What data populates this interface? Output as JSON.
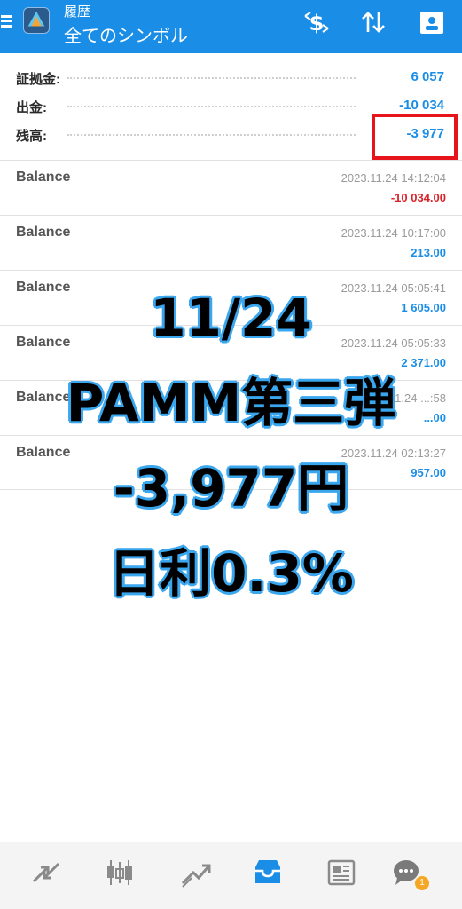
{
  "header": {
    "subtitle": "履歴",
    "title": "全てのシンボル",
    "icons": [
      "menu-icon",
      "app-logo",
      "currency-filter-icon",
      "sort-icon",
      "report-icon"
    ]
  },
  "summary": [
    {
      "label": "証拠金:",
      "value": "6 057"
    },
    {
      "label": "出金:",
      "value": "-10 034"
    },
    {
      "label": "残高:",
      "value": "-3 977"
    }
  ],
  "deals": [
    {
      "type": "Balance",
      "time": "2023.11.24 14:12:04",
      "amount": "-10 034.00",
      "negative": true
    },
    {
      "type": "Balance",
      "time": "2023.11.24 10:17:00",
      "amount": "213.00",
      "negative": false
    },
    {
      "type": "Balance",
      "time": "2023.11.24 05:05:41",
      "amount": "1 605.00",
      "negative": false
    },
    {
      "type": "Balance",
      "time": "2023.11.24 05:05:33",
      "amount": "2 371.00",
      "negative": false
    },
    {
      "type": "Balance",
      "time": "2023.11.24 ...:58",
      "amount": "...00",
      "negative": false
    },
    {
      "type": "Balance",
      "time": "2023.11.24 02:13:27",
      "amount": "957.00",
      "negative": false
    }
  ],
  "overlay": {
    "line1": "11/24",
    "line2": "PAMM第三弾",
    "line3": "-3,977円",
    "line4": "日利0.3%"
  },
  "bottom_nav": {
    "items": [
      "trade-icon",
      "chart-icon",
      "quotes-icon",
      "history-icon",
      "news-icon",
      "chat-icon"
    ],
    "chat_badge": "1"
  },
  "colors": {
    "header": "#1a8ee6",
    "positive": "#1a8ee6",
    "negative": "#d9232a",
    "highlight": "#e8141c",
    "overlay_stroke": "#39a6ee"
  }
}
